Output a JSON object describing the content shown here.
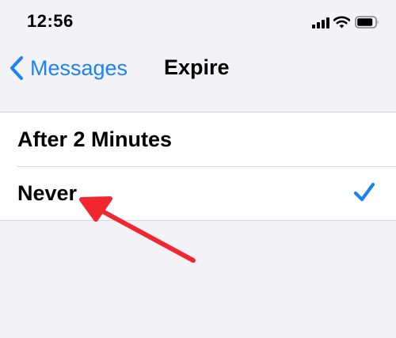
{
  "status_bar": {
    "time": "12:56",
    "icons": [
      "cellular-signal-icon",
      "wifi-icon",
      "battery-icon"
    ]
  },
  "nav": {
    "back_label": "Messages",
    "back_icon": "chevron-left-icon",
    "title": "Expire"
  },
  "options": [
    {
      "label": "After 2 Minutes",
      "selected": false
    },
    {
      "label": "Never",
      "selected": true,
      "indicator_icon": "checkmark-icon"
    }
  ],
  "annotation": {
    "type": "arrow",
    "icon": "red-arrow-icon",
    "color": "#f0272e",
    "points_to": "Never"
  },
  "colors": {
    "accent": "#1a82f7",
    "background": "#f2f2f7",
    "row_background": "#ffffff",
    "separator": "#d6d6dc",
    "annotation": "#f0272e"
  }
}
